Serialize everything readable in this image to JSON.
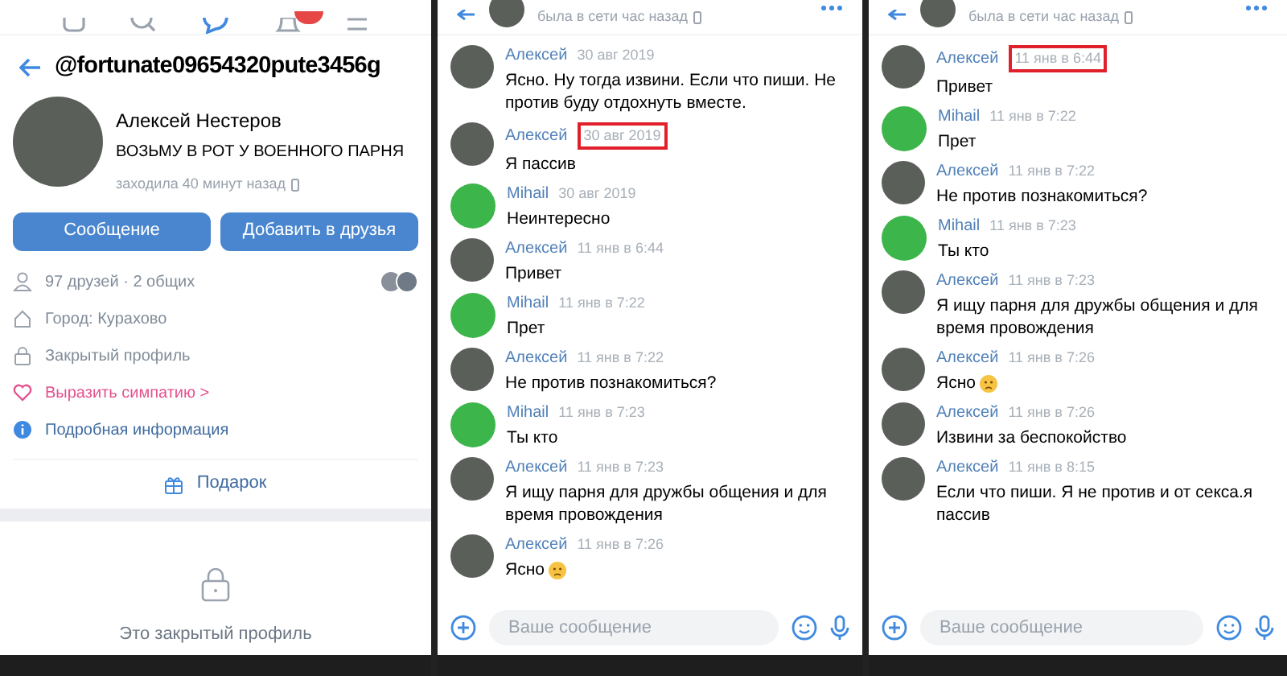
{
  "profile_screen": {
    "handle": "@fortunate09654320pute3456g",
    "name": "Алексей Нестеров",
    "status": "ВОЗЬМУ В РОТ У ВОЕННОГО ПАРНЯ",
    "last_seen": "заходила 40 минут назад",
    "buttons": [
      "Сообщение",
      "Добавить в друзья"
    ],
    "info_rows": [
      {
        "kind": "friends",
        "text": "97 друзей · 2 общих"
      },
      {
        "kind": "city",
        "text": "Город: Курахово"
      },
      {
        "kind": "private",
        "text": "Закрытый профиль"
      },
      {
        "kind": "sympathy",
        "text": "Выразить симпатию >"
      },
      {
        "kind": "details",
        "text": "Подробная информация"
      }
    ],
    "gift": "Подарок",
    "private_notice": "Это закрытый профиль"
  },
  "chats": [
    {
      "last_seen": "была в сети час назад",
      "input_placeholder": "Ваше сообщение",
      "messages": [
        {
          "author": "Алексей",
          "kind": "photo",
          "time": "30 авг 2019",
          "highlighted": false,
          "text": "Ясно. Ну тогда извини. Если что пиши. Не против буду отдохнуть вместе."
        },
        {
          "author": "Алексей",
          "kind": "photo",
          "time": "30 авг 2019",
          "highlighted": true,
          "text": "Я пассив"
        },
        {
          "author": "Mihail",
          "kind": "plain",
          "time": "30 авг 2019",
          "highlighted": false,
          "text": "Неинтересно"
        },
        {
          "author": "Алексей",
          "kind": "photo",
          "time": "11 янв в 6:44",
          "highlighted": false,
          "text": "Привет"
        },
        {
          "author": "Mihail",
          "kind": "plain",
          "time": "11 янв в 7:22",
          "highlighted": false,
          "text": "Прет"
        },
        {
          "author": "Алексей",
          "kind": "photo",
          "time": "11 янв в 7:22",
          "highlighted": false,
          "text": "Не против познакомиться?"
        },
        {
          "author": "Mihail",
          "kind": "plain",
          "time": "11 янв в 7:23",
          "highlighted": false,
          "text": "Ты кто"
        },
        {
          "author": "Алексей",
          "kind": "photo",
          "time": "11 янв в 7:23",
          "highlighted": false,
          "text": "Я ищу парня для дружбы общения и для время провождения"
        },
        {
          "author": "Алексей",
          "kind": "photo",
          "time": "11 янв в 7:26",
          "highlighted": false,
          "text": "Ясно",
          "sad_emoji": true
        }
      ]
    },
    {
      "last_seen": "была в сети час назад",
      "input_placeholder": "Ваше сообщение",
      "messages": [
        {
          "author": "Алексей",
          "kind": "photo",
          "time": "11 янв в 6:44",
          "highlighted": true,
          "text": "Привет"
        },
        {
          "author": "Mihail",
          "kind": "plain",
          "time": "11 янв в 7:22",
          "highlighted": false,
          "text": "Прет"
        },
        {
          "author": "Алексей",
          "kind": "photo",
          "time": "11 янв в 7:22",
          "highlighted": false,
          "text": "Не против познакомиться?"
        },
        {
          "author": "Mihail",
          "kind": "plain",
          "time": "11 янв в 7:23",
          "highlighted": false,
          "text": "Ты кто"
        },
        {
          "author": "Алексей",
          "kind": "photo",
          "time": "11 янв в 7:23",
          "highlighted": false,
          "text": "Я ищу парня для дружбы общения и для время провождения"
        },
        {
          "author": "Алексей",
          "kind": "photo",
          "time": "11 янв в 7:26",
          "highlighted": false,
          "text": "Ясно",
          "sad_emoji": true
        },
        {
          "author": "Алексей",
          "kind": "photo",
          "time": "11 янв в 7:26",
          "highlighted": false,
          "text": "Извини за беспокойство"
        },
        {
          "author": "Алексей",
          "kind": "photo",
          "time": "11 янв в 8:15",
          "highlighted": false,
          "text": "Если что пиши. Я не против и от секса.я пассив"
        }
      ]
    }
  ]
}
